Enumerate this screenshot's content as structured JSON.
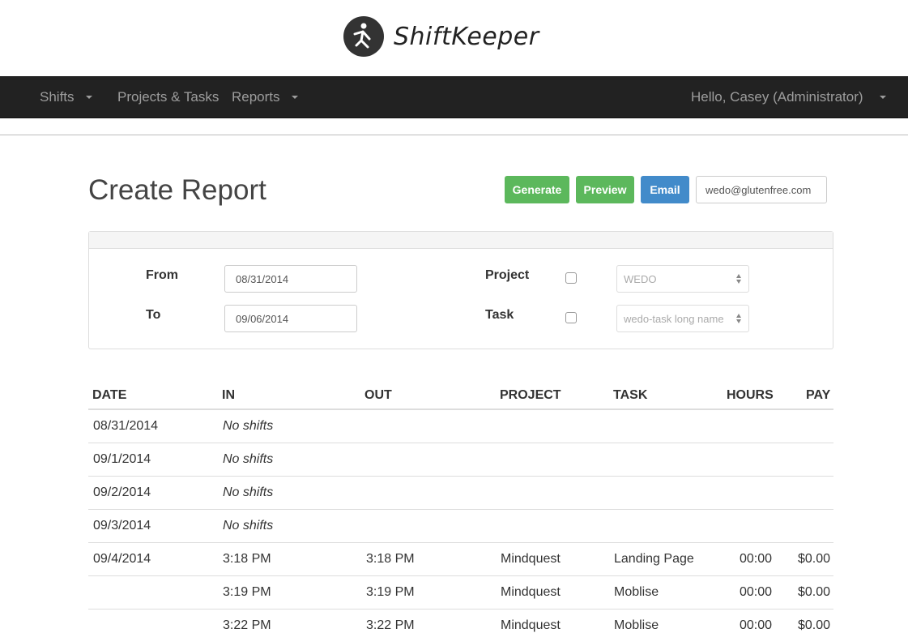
{
  "brand": {
    "name": "ShiftKeeper",
    "logo_icon": "running-figure-icon"
  },
  "nav": {
    "shifts": "Shifts",
    "projects_tasks": "Projects & Tasks",
    "reports": "Reports",
    "user_greeting": "Hello, Casey (Administrator)"
  },
  "page": {
    "title": "Create Report",
    "generate_label": "Generate",
    "preview_label": "Preview",
    "email_label": "Email",
    "email_value": "wedo@glutenfree.com"
  },
  "filters": {
    "from_label": "From",
    "from_value": "08/31/2014",
    "to_label": "To",
    "to_value": "09/06/2014",
    "project_label": "Project",
    "project_checked": false,
    "project_value": "WEDO",
    "task_label": "Task",
    "task_checked": false,
    "task_value": "wedo-task long name"
  },
  "table": {
    "headers": {
      "date": "DATE",
      "in": "IN",
      "out": "OUT",
      "project": "PROJECT",
      "task": "TASK",
      "hours": "HOURS",
      "pay": "PAY"
    },
    "rows": [
      {
        "date": "08/31/2014",
        "in": "No shifts",
        "out": "",
        "project": "",
        "task": "",
        "hours": "",
        "pay": ""
      },
      {
        "date": "09/1/2014",
        "in": "No shifts",
        "out": "",
        "project": "",
        "task": "",
        "hours": "",
        "pay": ""
      },
      {
        "date": "09/2/2014",
        "in": "No shifts",
        "out": "",
        "project": "",
        "task": "",
        "hours": "",
        "pay": ""
      },
      {
        "date": "09/3/2014",
        "in": "No shifts",
        "out": "",
        "project": "",
        "task": "",
        "hours": "",
        "pay": ""
      },
      {
        "date": "09/4/2014",
        "in": "3:18 PM",
        "out": "3:18 PM",
        "project": "Mindquest",
        "task": "Landing Page",
        "hours": "00:00",
        "pay": "$0.00"
      },
      {
        "date": "",
        "in": "3:19 PM",
        "out": "3:19 PM",
        "project": "Mindquest",
        "task": "Moblise",
        "hours": "00:00",
        "pay": "$0.00"
      },
      {
        "date": "",
        "in": "3:22 PM",
        "out": "3:22 PM",
        "project": "Mindquest",
        "task": "Moblise",
        "hours": "00:00",
        "pay": "$0.00"
      }
    ]
  }
}
